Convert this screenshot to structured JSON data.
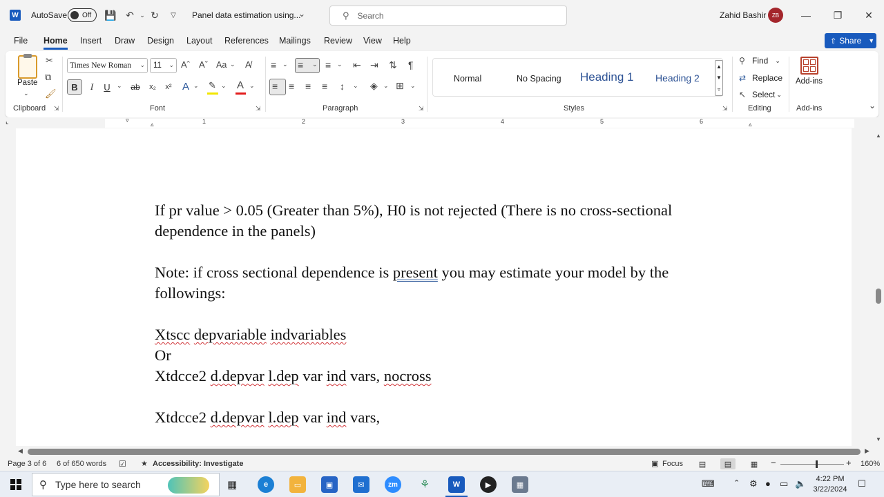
{
  "titlebar": {
    "app_letter": "W",
    "autosave_label": "AutoSave",
    "autosave_state": "Off",
    "doc_title": "Panel data estimation using...",
    "search_placeholder": "Search",
    "user_name": "Zahid Bashir",
    "user_initials": "ZB"
  },
  "menu": {
    "tabs": [
      "File",
      "Home",
      "Insert",
      "Draw",
      "Design",
      "Layout",
      "References",
      "Mailings",
      "Review",
      "View",
      "Help"
    ],
    "active": "Home",
    "share_label": "Share"
  },
  "ribbon": {
    "clipboard": {
      "paste_label": "Paste",
      "group_label": "Clipboard"
    },
    "font": {
      "font_name": "Times New Roman",
      "font_size": "11",
      "case_label": "Aa",
      "group_label": "Font",
      "bold": "B",
      "italic": "I",
      "underline": "U",
      "strike": "ab",
      "subscript": "x₂",
      "superscript": "x²"
    },
    "paragraph": {
      "group_label": "Paragraph"
    },
    "styles": {
      "items": [
        "Normal",
        "No Spacing",
        "Heading 1",
        "Heading 2"
      ],
      "group_label": "Styles"
    },
    "editing": {
      "find": "Find",
      "replace": "Replace",
      "select": "Select",
      "group_label": "Editing"
    },
    "addins": {
      "label": "Add-ins",
      "group_label": "Add-ins"
    }
  },
  "ruler": {
    "numbers": [
      "1",
      "2",
      "3",
      "4",
      "5",
      "6"
    ]
  },
  "document": {
    "line1a": "If pr value > 0.05 (Greater than 5%), H0 is not rejected (There is no cross-sectional",
    "line1b": "dependence in the panels)",
    "line2a_pre": "Note: if cross sectional dependence is ",
    "line2a_word": "present",
    "line2a_post": " you may estimate your model by the",
    "line2b": "followings:",
    "cmd1": [
      "Xtscc",
      "depvariable",
      "indvariables"
    ],
    "or": "Or",
    "cmd2": [
      "Xtdcce2",
      "d.depvar",
      "l.dep",
      "var",
      "ind",
      "vars,",
      "nocross"
    ],
    "cmd3": [
      "Xtdcce2",
      "d.depvar",
      "l.dep",
      "var",
      "ind",
      "vars,"
    ]
  },
  "status": {
    "page": "Page 3 of 6",
    "words": "6 of 650 words",
    "accessibility": "Accessibility: Investigate",
    "focus": "Focus",
    "zoom_pct": "160%"
  },
  "taskbar": {
    "search_placeholder": "Type here to search",
    "time": "4:22 PM",
    "date": "3/22/2024",
    "zoom_app": "zm",
    "word_app": "W"
  },
  "colors": {
    "accent": "#185abd",
    "avatar": "#a4262c",
    "heading": "#2f5496",
    "spell": "#d13438"
  }
}
